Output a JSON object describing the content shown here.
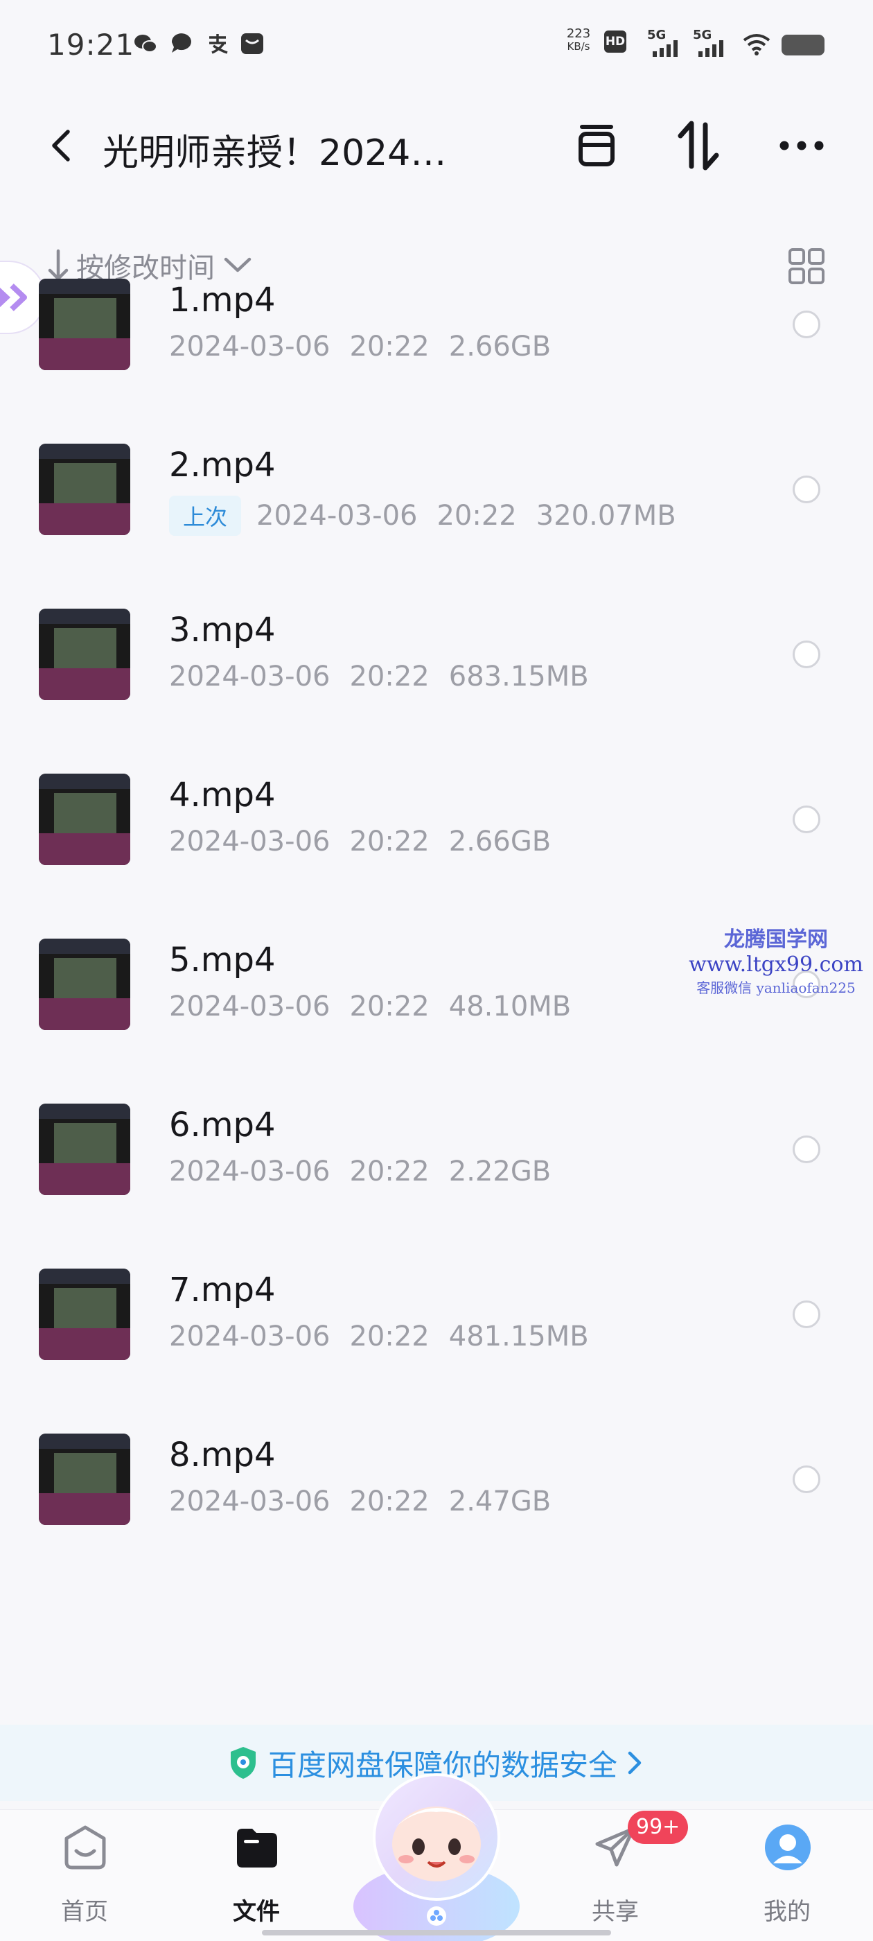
{
  "status_bar": {
    "time": "19:21",
    "net_speed_top": "223",
    "net_speed_bottom": "KB/s",
    "hd_label": "HD",
    "signal_1": "5G",
    "signal_2": "5G",
    "icons": [
      "wechat-icon",
      "message-icon",
      "alipay-icon",
      "notification-icon",
      "wifi-icon",
      "battery-icon"
    ]
  },
  "header": {
    "title": "光明师亲授！2024…",
    "back_icon": "chevron-left-icon",
    "actions": [
      "archive-icon",
      "transfer-icon",
      "more-icon"
    ]
  },
  "sort": {
    "label": "按修改时间",
    "arrow_icon": "arrow-down-icon",
    "dropdown_icon": "chevron-down-icon",
    "view_toggle_icon": "grid-view-icon"
  },
  "files": [
    {
      "name": "1.mp4",
      "date": "2024-03-06",
      "time": "20:22",
      "size": "2.66GB",
      "badge": ""
    },
    {
      "name": "2.mp4",
      "date": "2024-03-06",
      "time": "20:22",
      "size": "320.07MB",
      "badge": "上次"
    },
    {
      "name": "3.mp4",
      "date": "2024-03-06",
      "time": "20:22",
      "size": "683.15MB",
      "badge": ""
    },
    {
      "name": "4.mp4",
      "date": "2024-03-06",
      "time": "20:22",
      "size": "2.66GB",
      "badge": ""
    },
    {
      "name": "5.mp4",
      "date": "2024-03-06",
      "time": "20:22",
      "size": "48.10MB",
      "badge": ""
    },
    {
      "name": "6.mp4",
      "date": "2024-03-06",
      "time": "20:22",
      "size": "2.22GB",
      "badge": ""
    },
    {
      "name": "7.mp4",
      "date": "2024-03-06",
      "time": "20:22",
      "size": "481.15MB",
      "badge": ""
    },
    {
      "name": "8.mp4",
      "date": "2024-03-06",
      "time": "20:22",
      "size": "2.47GB",
      "badge": ""
    }
  ],
  "watermark": {
    "line1": "龙腾国学网",
    "line2": "www.ltgx99.com",
    "line3": "客服微信 yanliaofan225"
  },
  "security_banner": {
    "text": "百度网盘保障你的数据安全",
    "icon": "shield-icon"
  },
  "tab_bar": {
    "tabs": [
      {
        "label": "首页",
        "icon": "home-icon"
      },
      {
        "label": "文件",
        "icon": "folder-icon"
      },
      {
        "label": "共享",
        "icon": "share-plane-icon"
      },
      {
        "label": "我的",
        "icon": "avatar-icon"
      }
    ],
    "share_badge": "99+"
  },
  "colors": {
    "accent": "#2b8fe0",
    "badge_red": "#f0445a",
    "background": "#f7f7fa"
  }
}
